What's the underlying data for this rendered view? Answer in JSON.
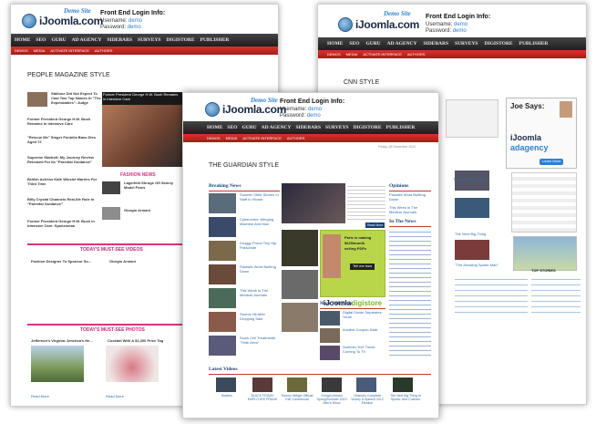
{
  "brand": {
    "name": "iJoomla.com",
    "tag": "Demo Site"
  },
  "login": {
    "title": "Front End Login Info:",
    "user_label": "Username:",
    "user": "demo",
    "pass_label": "Password:",
    "pass": "demo"
  },
  "nav": [
    "HOME",
    "SEO",
    "GURU",
    "AD AGENCY",
    "SIDEBARS",
    "SURVEYS",
    "DIGISTORE",
    "PUBLISHER"
  ],
  "subnav": [
    "DEMOS",
    "MEDIA",
    "ACTIVATE INTERFACE",
    "AUTHORS"
  ],
  "people": {
    "title": "PEOPLE MAGAZINE STYLE",
    "stories": [
      "Stallone Did Not Expect To Cast Two Top Names In \"The Expendables\": Judge",
      "Former President George H.W. Bush Remains In Intensive Care",
      "\"Rescue Me\" Singer Fontella Bass Dies Aged 72",
      "Supreme Starbolt: My Journey Review Released For Its \"Parental Guidance\"",
      "British Actress Kate Winslet Marries For Third Time",
      "Billy Crystal Channels Real-life Role in \"Parental Guidance\"",
      "Former President George H.W. Bush In Intensive Care: Spokesman"
    ],
    "feature": "Former President George H.W. Bush Remains in Intensive Care",
    "fashion": "FASHION NEWS",
    "fashion_items": [
      "Lagerfeld Shrugs Off Skinny Model Fears",
      "Giorgio Armani"
    ],
    "videos_title": "TODAY'S MUST-SEE VIDEOS",
    "videos": [
      "Fashion Designer To Sponsor So...",
      "Giorgio Armani"
    ],
    "photos_title": "TODAY'S MUST-SEE PHOTOS",
    "photos": [
      "Jefferson's Virginia: America's He...",
      "Cocktail With A $1,400 Price Tag"
    ],
    "read_more": "Read More"
  },
  "cnn": {
    "title": "CNN STYLE",
    "ad_title": "Joe Says:",
    "ad_lines": [
      "iJoomla",
      "adagency"
    ],
    "ad_btn": "Learn More",
    "top_stories": "TOP STORIES",
    "headlines": [
      "Tommy Hilfiger Offe...",
      "The Next Big Thing",
      "\"The Amazing Spider-Man\""
    ]
  },
  "guardian": {
    "title": "THE GUARDIAN STYLE",
    "breaking": "Breaking News",
    "breaking_items": [
      "Suomer Strife Storms In Staff In House",
      "Cybercrime: Merging Machine And Man",
      "Druggy Proud Tiny Hip Parachute",
      "Parasite Word Bullfrog Down",
      "This Week In The Medical Journals",
      "Storms Hit After Dropping Sale",
      "Snow Cell Treatments \"Yeah Area\""
    ],
    "opinions": "Opinions",
    "opinion_items": [
      "Parasite Word Bullfrog Down",
      "This Week In The Medical Journals"
    ],
    "in_news": "In The News",
    "more_tech": "More Tech News",
    "tech_items": [
      "Digital Divide Separates Youth",
      "Ancient Coupon Data",
      "Summer 'Kid' Tunes Coming To TV"
    ],
    "latest_videos": "Latest Videos",
    "video_captions": [
      "Beatles",
      "BLACK FRIDAY EMPLOYEE PRANK",
      "Tommy Hilfiger Official Fall Commercial",
      "Giorgio Armani Spring/Summer 2013 Men's Show",
      "Obama's Complete Victory & Speech 2012 Election",
      "The Next Big Thing In Sports: Arm-Cushion"
    ],
    "digistore_lines": [
      "Paris is making",
      "$625/month",
      "selling PDFs"
    ],
    "digistore_btn": "Tell me how",
    "digistore_brand": "iJoomla",
    "digistore_name": "digistore",
    "read_more": "Read More",
    "date": "Friday, 28 December 2012"
  }
}
